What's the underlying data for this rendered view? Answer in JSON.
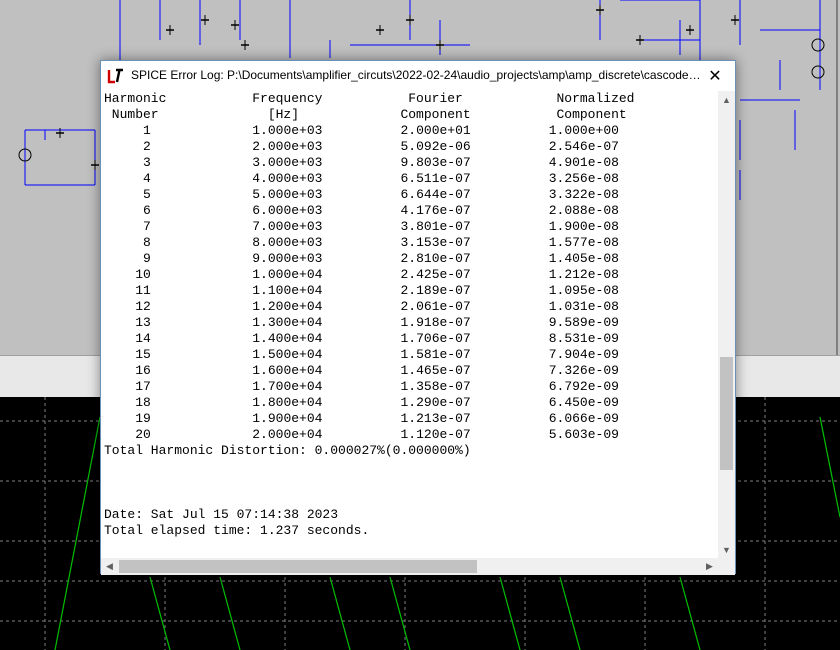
{
  "dialog": {
    "title": "SPICE Error Log: P:\\Documents\\amplifier_circuts\\2022-02-24\\audio_projects\\amp\\amp_discrete\\cascoder_...",
    "close_glyph": "✕",
    "app_icon": "ltspice-icon"
  },
  "fourier": {
    "header1": "Harmonic           Frequency           Fourier            Normalized",
    "header2": " Number              [Hz]             Component           Component",
    "rows": [
      {
        "n": "1",
        "freq": "1.000e+03",
        "fourier": "2.000e+01",
        "normalized": "1.000e+00"
      },
      {
        "n": "2",
        "freq": "2.000e+03",
        "fourier": "5.092e-06",
        "normalized": "2.546e-07"
      },
      {
        "n": "3",
        "freq": "3.000e+03",
        "fourier": "9.803e-07",
        "normalized": "4.901e-08"
      },
      {
        "n": "4",
        "freq": "4.000e+03",
        "fourier": "6.511e-07",
        "normalized": "3.256e-08"
      },
      {
        "n": "5",
        "freq": "5.000e+03",
        "fourier": "6.644e-07",
        "normalized": "3.322e-08"
      },
      {
        "n": "6",
        "freq": "6.000e+03",
        "fourier": "4.176e-07",
        "normalized": "2.088e-08"
      },
      {
        "n": "7",
        "freq": "7.000e+03",
        "fourier": "3.801e-07",
        "normalized": "1.900e-08"
      },
      {
        "n": "8",
        "freq": "8.000e+03",
        "fourier": "3.153e-07",
        "normalized": "1.577e-08"
      },
      {
        "n": "9",
        "freq": "9.000e+03",
        "fourier": "2.810e-07",
        "normalized": "1.405e-08"
      },
      {
        "n": "10",
        "freq": "1.000e+04",
        "fourier": "2.425e-07",
        "normalized": "1.212e-08"
      },
      {
        "n": "11",
        "freq": "1.100e+04",
        "fourier": "2.189e-07",
        "normalized": "1.095e-08"
      },
      {
        "n": "12",
        "freq": "1.200e+04",
        "fourier": "2.061e-07",
        "normalized": "1.031e-08"
      },
      {
        "n": "13",
        "freq": "1.300e+04",
        "fourier": "1.918e-07",
        "normalized": "9.589e-09"
      },
      {
        "n": "14",
        "freq": "1.400e+04",
        "fourier": "1.706e-07",
        "normalized": "8.531e-09"
      },
      {
        "n": "15",
        "freq": "1.500e+04",
        "fourier": "1.581e-07",
        "normalized": "7.904e-09"
      },
      {
        "n": "16",
        "freq": "1.600e+04",
        "fourier": "1.465e-07",
        "normalized": "7.326e-09"
      },
      {
        "n": "17",
        "freq": "1.700e+04",
        "fourier": "1.358e-07",
        "normalized": "6.792e-09"
      },
      {
        "n": "18",
        "freq": "1.800e+04",
        "fourier": "1.290e-07",
        "normalized": "6.450e-09"
      },
      {
        "n": "19",
        "freq": "1.900e+04",
        "fourier": "1.213e-07",
        "normalized": "6.066e-09"
      },
      {
        "n": "20",
        "freq": "2.000e+04",
        "fourier": "1.120e-07",
        "normalized": "5.603e-09"
      }
    ],
    "thd": "Total Harmonic Distortion: 0.000027%(0.000000%)"
  },
  "footer": {
    "date": "Date: Sat Jul 15 07:14:38 2023",
    "elapsed": "Total elapsed time: 1.237 seconds."
  },
  "scrollbars": {
    "up": "▲",
    "down": "▼",
    "left": "◀",
    "right": "▶"
  },
  "colors": {
    "waveform": "#00c000",
    "wire": "#0000ff",
    "component": "#000000",
    "plot_bg": "#000000",
    "schematic_bg": "#c0c0c0",
    "window_border": "#6b8fb5"
  }
}
